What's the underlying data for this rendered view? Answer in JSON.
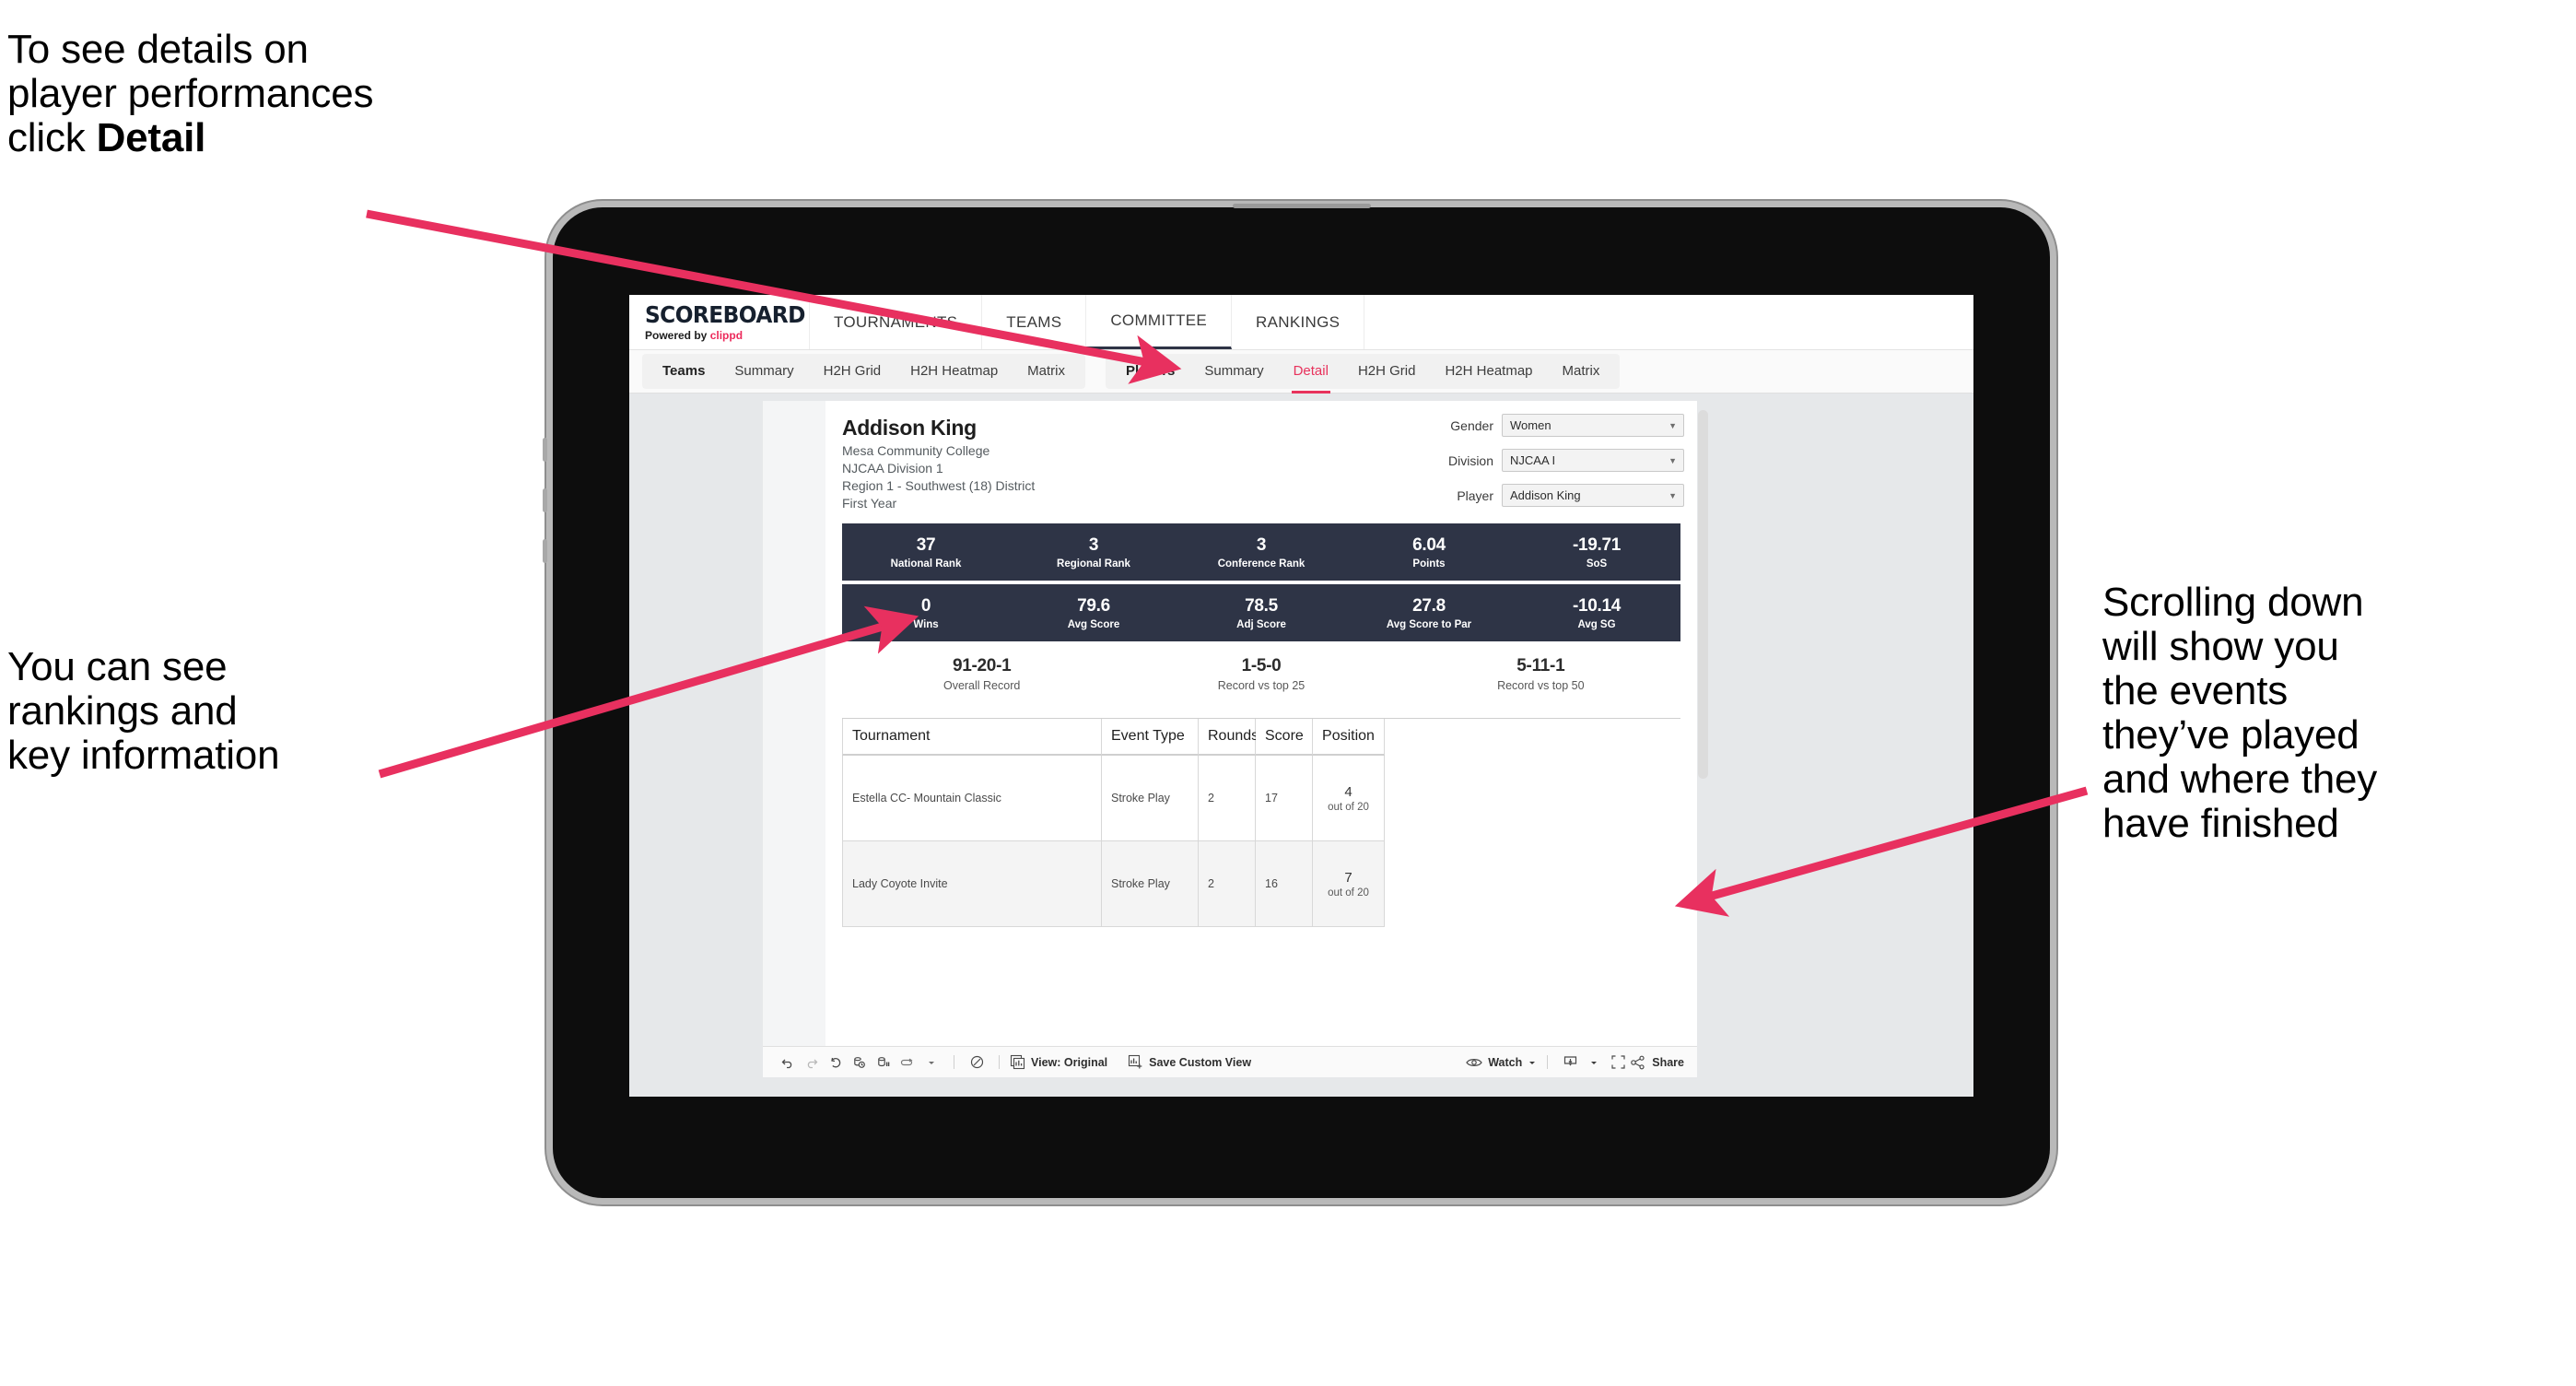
{
  "callouts": {
    "detail": "To see details on\nplayer performances\nclick ",
    "detail_bold": "Detail",
    "rankings": "You can see\nrankings and\nkey information",
    "scroll": "Scrolling down\nwill show you\nthe events\nthey’ve played\nand where they\nhave finished"
  },
  "colors": {
    "accent_pink": "#ec2a5b",
    "arrow_pink": "#e8305f",
    "navy": "#2e3446",
    "tab_active": "#e8325c"
  },
  "brand": {
    "title": "SCOREBOARD",
    "powered_prefix": "Powered by ",
    "powered_name": "clippd"
  },
  "topnav": [
    {
      "label": "TOURNAMENTS",
      "active": false
    },
    {
      "label": "TEAMS",
      "active": false
    },
    {
      "label": "COMMITTEE",
      "active": true
    },
    {
      "label": "RANKINGS",
      "active": false
    }
  ],
  "subnav": {
    "group_teams": [
      {
        "label": "Teams",
        "head": true
      },
      {
        "label": "Summary"
      },
      {
        "label": "H2H Grid"
      },
      {
        "label": "H2H Heatmap"
      },
      {
        "label": "Matrix"
      }
    ],
    "group_players": [
      {
        "label": "Players",
        "head": true
      },
      {
        "label": "Summary"
      },
      {
        "label": "Detail",
        "active": true
      },
      {
        "label": "H2H Grid"
      },
      {
        "label": "H2H Heatmap"
      },
      {
        "label": "Matrix"
      }
    ]
  },
  "player": {
    "name": "Addison King",
    "school": "Mesa Community College",
    "division": "NJCAA Division 1",
    "region": "Region 1 - Southwest (18) District",
    "year": "First Year"
  },
  "filters": [
    {
      "label": "Gender",
      "value": "Women"
    },
    {
      "label": "Division",
      "value": "NJCAA I"
    },
    {
      "label": "Player",
      "value": "Addison King"
    }
  ],
  "stats_row1": [
    {
      "value": "37",
      "label": "National Rank"
    },
    {
      "value": "3",
      "label": "Regional Rank"
    },
    {
      "value": "3",
      "label": "Conference Rank"
    },
    {
      "value": "6.04",
      "label": "Points"
    },
    {
      "value": "-19.71",
      "label": "SoS"
    }
  ],
  "stats_row2": [
    {
      "value": "0",
      "label": "Wins"
    },
    {
      "value": "79.6",
      "label": "Avg Score"
    },
    {
      "value": "78.5",
      "label": "Adj Score"
    },
    {
      "value": "27.8",
      "label": "Avg Score to Par"
    },
    {
      "value": "-10.14",
      "label": "Avg SG"
    }
  ],
  "records": [
    {
      "value": "91-20-1",
      "label": "Overall Record"
    },
    {
      "value": "1-5-0",
      "label": "Record vs top 25"
    },
    {
      "value": "5-11-1",
      "label": "Record vs top 50"
    }
  ],
  "table": {
    "headers": [
      "Tournament",
      "Event Type",
      "Rounds",
      "Score",
      "Position"
    ],
    "rows": [
      {
        "tournament": "Estella CC- Mountain Classic",
        "event_type": "Stroke Play",
        "rounds": "2",
        "score": "17",
        "position_num": "4",
        "position_of": "out of 20"
      },
      {
        "tournament": "Lady Coyote Invite",
        "event_type": "Stroke Play",
        "rounds": "2",
        "score": "16",
        "position_num": "7",
        "position_of": "out of 20"
      }
    ]
  },
  "vizbar": {
    "view_label": "View: Original",
    "save_label": "Save Custom View",
    "watch_label": "Watch",
    "share_label": "Share"
  }
}
